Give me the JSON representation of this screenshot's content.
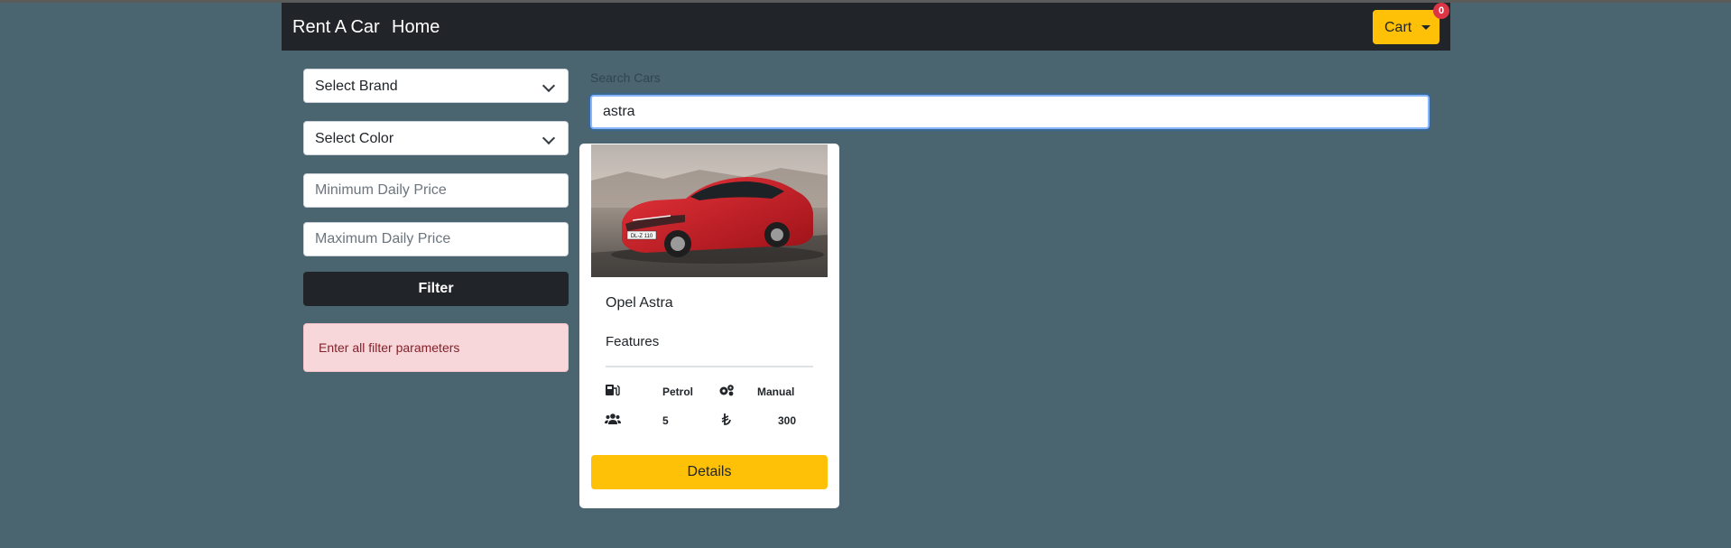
{
  "navbar": {
    "brand": "Rent A Car",
    "home": "Home",
    "cart_label": "Cart",
    "cart_count": "0"
  },
  "filters": {
    "brand_select": "Select Brand",
    "color_select": "Select Color",
    "min_price_placeholder": "Minimum Daily Price",
    "max_price_placeholder": "Maximum Daily Price",
    "filter_button": "Filter",
    "alert": "Enter all filter parameters"
  },
  "search": {
    "label": "Search Cars",
    "value": "astra"
  },
  "car_card": {
    "title": "Opel Astra",
    "features_label": "Features",
    "fuel": "Petrol",
    "transmission": "Manual",
    "seats": "5",
    "price": "300",
    "details_button": "Details",
    "plate": "DL-Z 110",
    "icons": [
      "gas-pump-icon",
      "gears-icon",
      "users-icon",
      "lira-icon"
    ]
  },
  "colors": {
    "background": "#4a6470",
    "navbar": "#212529",
    "accent": "#ffc107",
    "badge": "#dc3545",
    "alert_bg": "#f8d7da",
    "alert_text": "#842029"
  }
}
